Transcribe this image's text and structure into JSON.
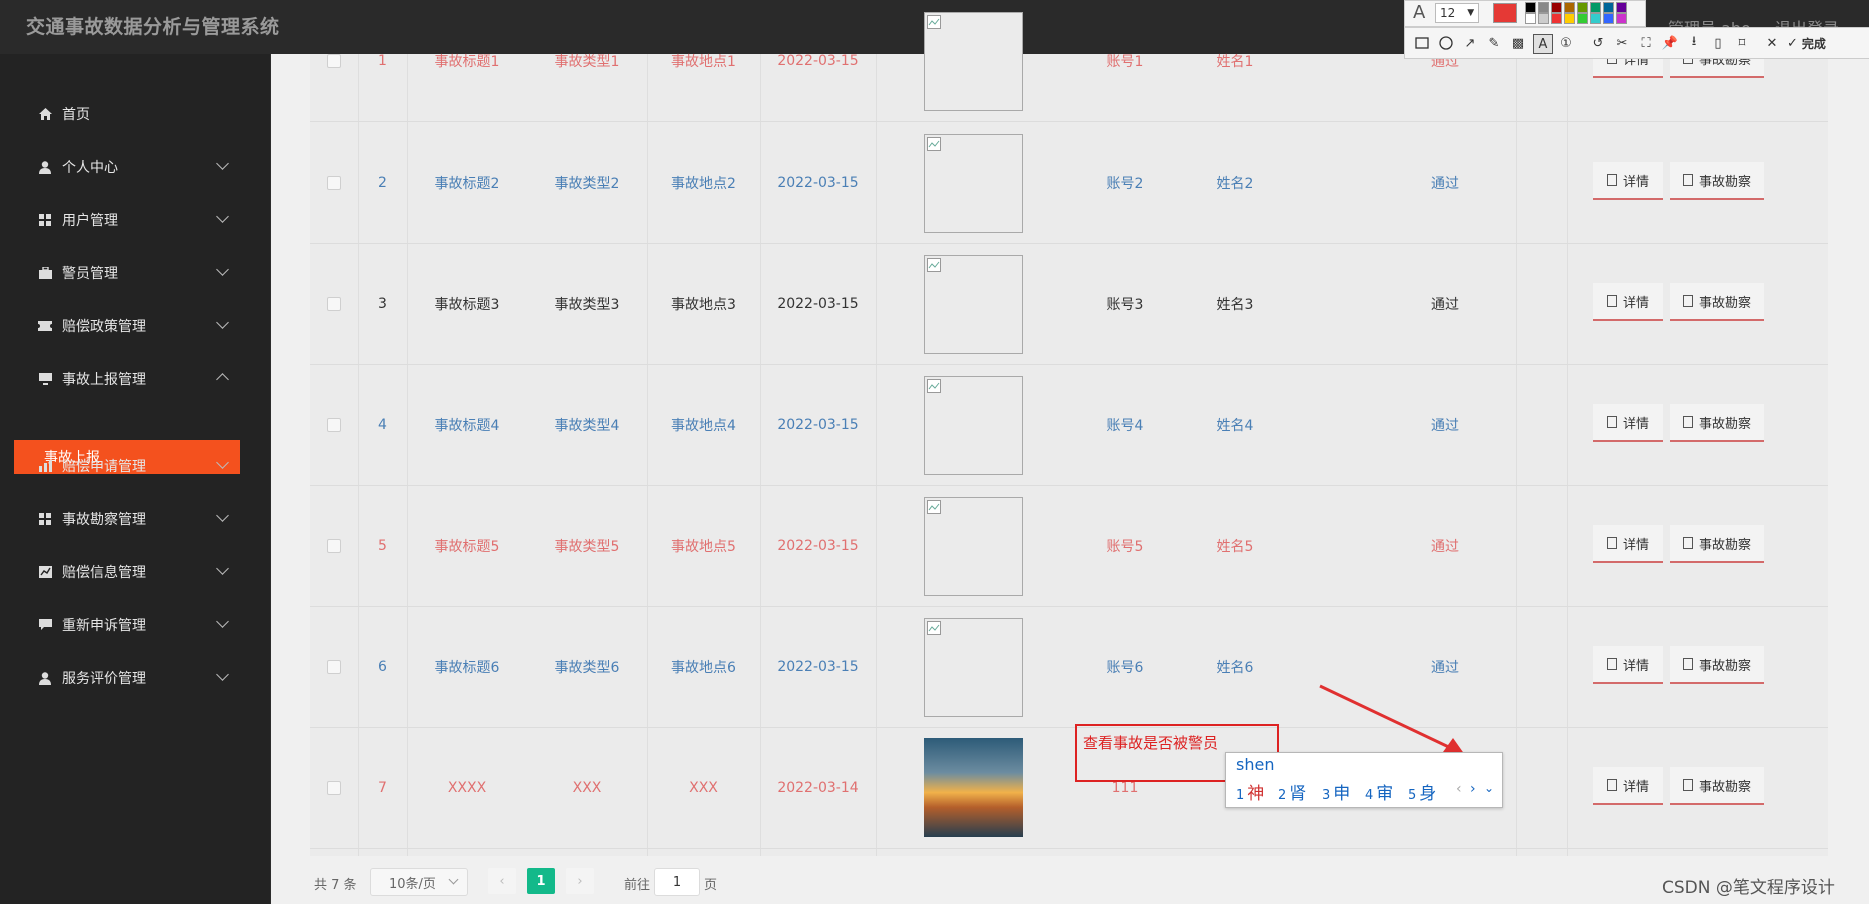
{
  "app_title": "交通事故数据分析与管理系统",
  "header": {
    "admin_label": "管理员 abo",
    "logout_label": "退出登录"
  },
  "sidebar": {
    "items": [
      {
        "label": "首页",
        "icon": "home-icon"
      },
      {
        "label": "个人中心",
        "icon": "user-icon"
      },
      {
        "label": "用户管理",
        "icon": "grid-icon"
      },
      {
        "label": "警员管理",
        "icon": "briefcase-icon"
      },
      {
        "label": "赔偿政策管理",
        "icon": "ticket-icon"
      },
      {
        "label": "事故上报管理",
        "icon": "monitor-icon"
      },
      {
        "label": "赔偿申请管理",
        "icon": "chart-icon"
      },
      {
        "label": "事故勘察管理",
        "icon": "grid-icon"
      },
      {
        "label": "赔偿信息管理",
        "icon": "line-chart-icon"
      },
      {
        "label": "重新申诉管理",
        "icon": "comment-icon"
      },
      {
        "label": "服务评价管理",
        "icon": "user-icon"
      }
    ],
    "active_sub": "事故上报"
  },
  "table": {
    "rows": [
      {
        "no": "1",
        "title": "事故标题1",
        "type": "事故类型1",
        "place": "事故地点1",
        "date": "2022-03-15",
        "account": "账号1",
        "name": "姓名1",
        "status": "通过",
        "color": "#e07070"
      },
      {
        "no": "2",
        "title": "事故标题2",
        "type": "事故类型2",
        "place": "事故地点2",
        "date": "2022-03-15",
        "account": "账号2",
        "name": "姓名2",
        "status": "通过",
        "color": "#4a7fb5"
      },
      {
        "no": "3",
        "title": "事故标题3",
        "type": "事故类型3",
        "place": "事故地点3",
        "date": "2022-03-15",
        "account": "账号3",
        "name": "姓名3",
        "status": "通过",
        "color": "#333333"
      },
      {
        "no": "4",
        "title": "事故标题4",
        "type": "事故类型4",
        "place": "事故地点4",
        "date": "2022-03-15",
        "account": "账号4",
        "name": "姓名4",
        "status": "通过",
        "color": "#4a7fb5"
      },
      {
        "no": "5",
        "title": "事故标题5",
        "type": "事故类型5",
        "place": "事故地点5",
        "date": "2022-03-15",
        "account": "账号5",
        "name": "姓名5",
        "status": "通过",
        "color": "#e07070"
      },
      {
        "no": "6",
        "title": "事故标题6",
        "type": "事故类型6",
        "place": "事故地点6",
        "date": "2022-03-15",
        "account": "账号6",
        "name": "姓名6",
        "status": "通过",
        "color": "#4a7fb5"
      },
      {
        "no": "7",
        "title": "XXXX",
        "type": "XXX",
        "place": "XXX",
        "date": "2022-03-14",
        "account": "111",
        "name": "",
        "status": "",
        "color": "#e07070"
      }
    ],
    "detail_label": "详情",
    "survey_label": "事故勘察"
  },
  "pager": {
    "total": "共 7 条",
    "page_size": "10条/页",
    "current": "1",
    "goto_prefix": "前往",
    "goto_value": "1",
    "goto_suffix": "页"
  },
  "annotation": {
    "text": "查看事故是否被警员"
  },
  "ime": {
    "pinyin": "shen",
    "candidates": [
      {
        "n": "1",
        "c": "神"
      },
      {
        "n": "2",
        "c": "肾"
      },
      {
        "n": "3",
        "c": "申"
      },
      {
        "n": "4",
        "c": "审"
      },
      {
        "n": "5",
        "c": "身"
      }
    ]
  },
  "toolbar": {
    "font_size": "12",
    "done_label": "完成"
  },
  "watermark": "CSDN @笔文程序设计"
}
